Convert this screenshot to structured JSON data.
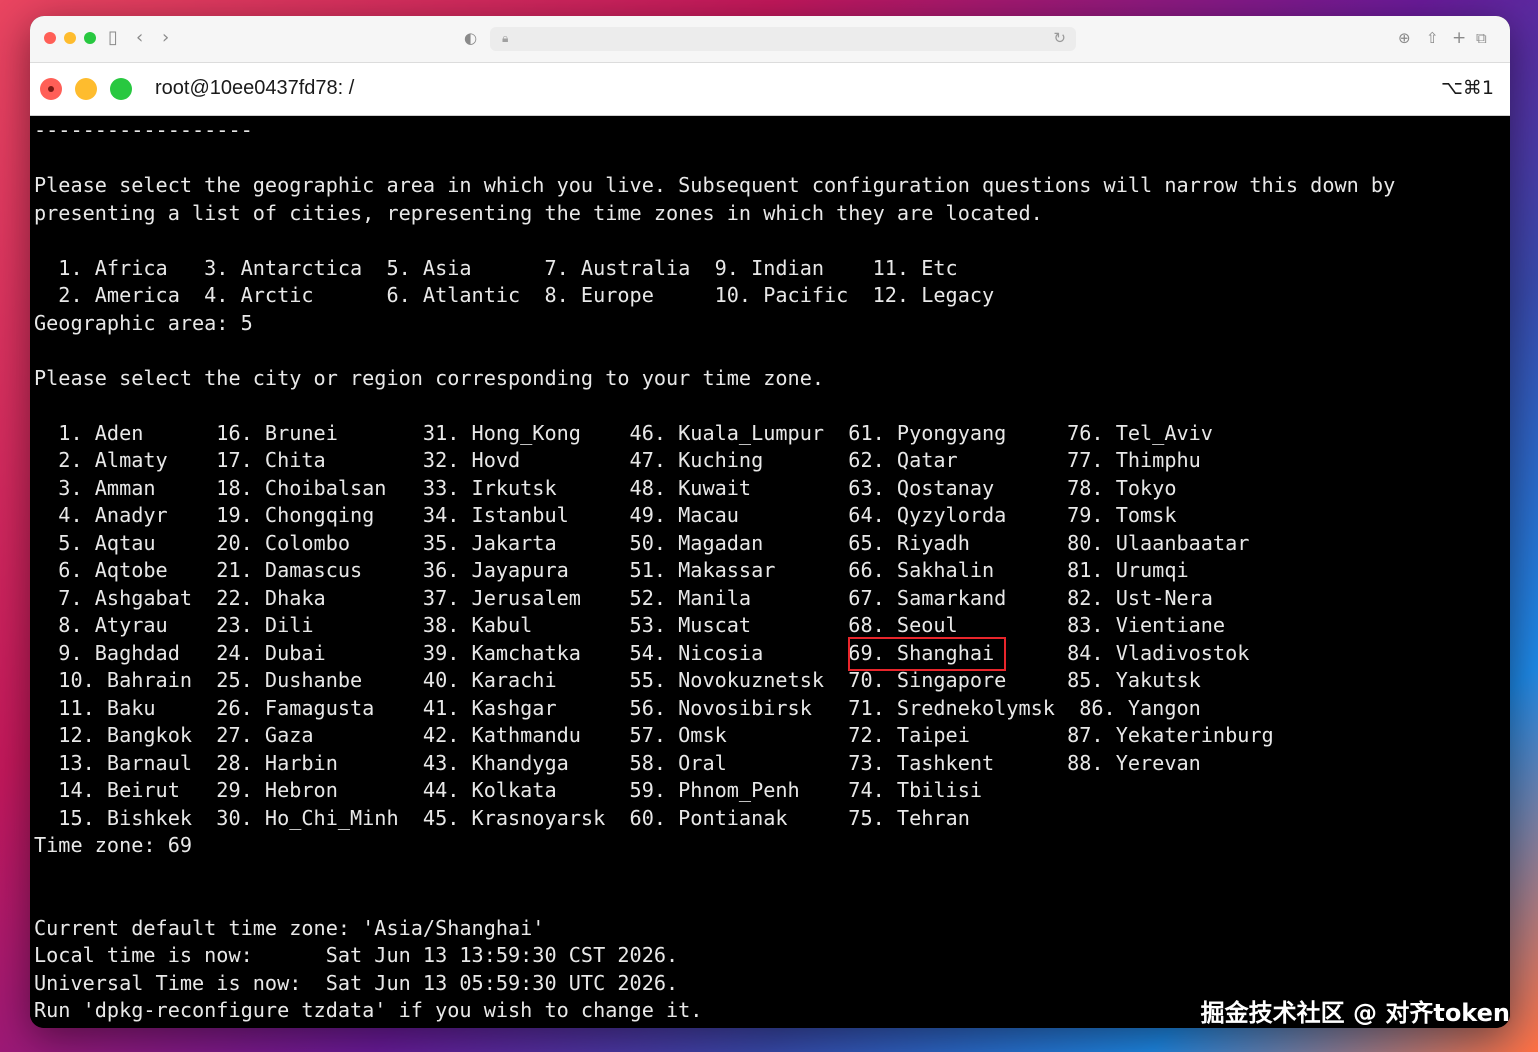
{
  "terminal": {
    "title": "root@10ee0437fd78: /",
    "shortcut": "⌥⌘1",
    "lines": [
      "------------------",
      "",
      "Please select the geographic area in which you live. Subsequent configuration questions will narrow this down by",
      "presenting a list of cities, representing the time zones in which they are located.",
      "",
      "  1. Africa   3. Antarctica  5. Asia      7. Australia  9. Indian    11. Etc",
      "  2. America  4. Arctic      6. Atlantic  8. Europe     10. Pacific  12. Legacy",
      "Geographic area: 5",
      "",
      "Please select the city or region corresponding to your time zone.",
      "",
      "  1. Aden      16. Brunei       31. Hong_Kong    46. Kuala_Lumpur  61. Pyongyang     76. Tel_Aviv",
      "  2. Almaty    17. Chita        32. Hovd         47. Kuching       62. Qatar         77. Thimphu",
      "  3. Amman     18. Choibalsan   33. Irkutsk      48. Kuwait        63. Qostanay      78. Tokyo",
      "  4. Anadyr    19. Chongqing    34. Istanbul     49. Macau         64. Qyzylorda     79. Tomsk",
      "  5. Aqtau     20. Colombo      35. Jakarta      50. Magadan       65. Riyadh        80. Ulaanbaatar",
      "  6. Aqtobe    21. Damascus     36. Jayapura     51. Makassar      66. Sakhalin      81. Urumqi",
      "  7. Ashgabat  22. Dhaka        37. Jerusalem    52. Manila        67. Samarkand     82. Ust-Nera",
      "  8. Atyrau    23. Dili         38. Kabul        53. Muscat        68. Seoul         83. Vientiane",
      "  9. Baghdad   24. Dubai        39. Kamchatka    54. Nicosia       69. Shanghai      84. Vladivostok",
      "  10. Bahrain  25. Dushanbe     40. Karachi      55. Novokuznetsk  70. Singapore     85. Yakutsk",
      "  11. Baku     26. Famagusta    41. Kashgar      56. Novosibirsk   71. Srednekolymsk  86. Yangon",
      "  12. Bangkok  27. Gaza         42. Kathmandu    57. Omsk          72. Taipei        87. Yekaterinburg",
      "  13. Barnaul  28. Harbin       43. Khandyga     58. Oral          73. Tashkent      88. Yerevan",
      "  14. Beirut   29. Hebron       44. Kolkata      59. Phnom_Penh    74. Tbilisi",
      "  15. Bishkek  30. Ho_Chi_Minh  45. Krasnoyarsk  60. Pontianak     75. Tehran",
      "Time zone: 69",
      "",
      "",
      "Current default time zone: 'Asia/Shanghai'",
      "Local time is now:      Sat Jun 13 13:59:30 CST 2026.",
      "Universal Time is now:  Sat Jun 13 05:59:30 UTC 2026.",
      "Run 'dpkg-reconfigure tzdata' if you wish to change it."
    ]
  },
  "watermark": "掘金技术社区 @ 对齐token"
}
